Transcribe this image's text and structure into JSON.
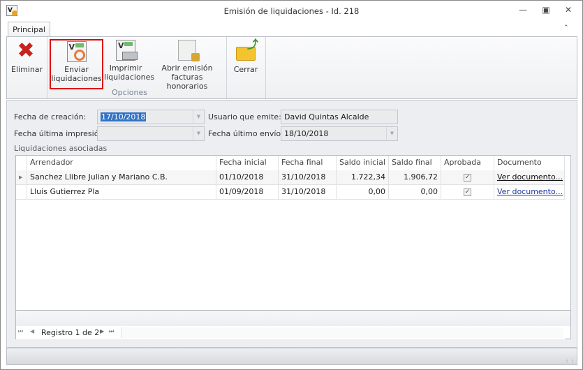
{
  "window": {
    "title": "Emisión de liquidaciones - Id. 218",
    "app_icon": "app-icon",
    "controls": [
      "minimize",
      "restore",
      "close"
    ]
  },
  "tabs": [
    {
      "label": "Principal"
    }
  ],
  "ribbon": {
    "buttons": [
      {
        "label1": "Eliminar",
        "label2": ""
      },
      {
        "label1": "Enviar",
        "label2": "liquidaciones"
      },
      {
        "label1": "Imprimir",
        "label2": "liquidaciones"
      },
      {
        "label1": "Abrir emisión",
        "label2": "facturas honorarios"
      },
      {
        "label1": "Cerrar",
        "label2": ""
      }
    ],
    "group_label": "Opciones",
    "highlight_color": "#e00000"
  },
  "form": {
    "fecha_creacion_label": "Fecha de creación:",
    "fecha_creacion": "17/10/2018",
    "usuario_label": "Usuario que emite:",
    "usuario": "David Quintas Alcalde",
    "fecha_impresion_label": "Fecha última impresión:",
    "fecha_impresion": "",
    "fecha_envio_label": "Fecha último envío:",
    "fecha_envio": "18/10/2018"
  },
  "grid": {
    "title": "Liquidaciones asociadas",
    "columns": [
      "Arrendador",
      "Fecha inicial",
      "Fecha final",
      "Saldo inicial",
      "Saldo final",
      "Aprobada",
      "Documento"
    ],
    "rows": [
      {
        "arrendador": "Sanchez Llibre Julian y Mariano C.B.",
        "fecha_inicial": "01/10/2018",
        "fecha_final": "31/10/2018",
        "saldo_inicial": "1.722,34",
        "saldo_final": "1.906,72",
        "aprobada": true,
        "documento": "Ver documento..."
      },
      {
        "arrendador": "Lluis Gutierrez Pla",
        "fecha_inicial": "01/09/2018",
        "fecha_final": "31/10/2018",
        "saldo_inicial": "0,00",
        "saldo_final": "0,00",
        "aprobada": true,
        "documento": "Ver documento..."
      }
    ],
    "navigator": "Registro 1 de 2"
  }
}
